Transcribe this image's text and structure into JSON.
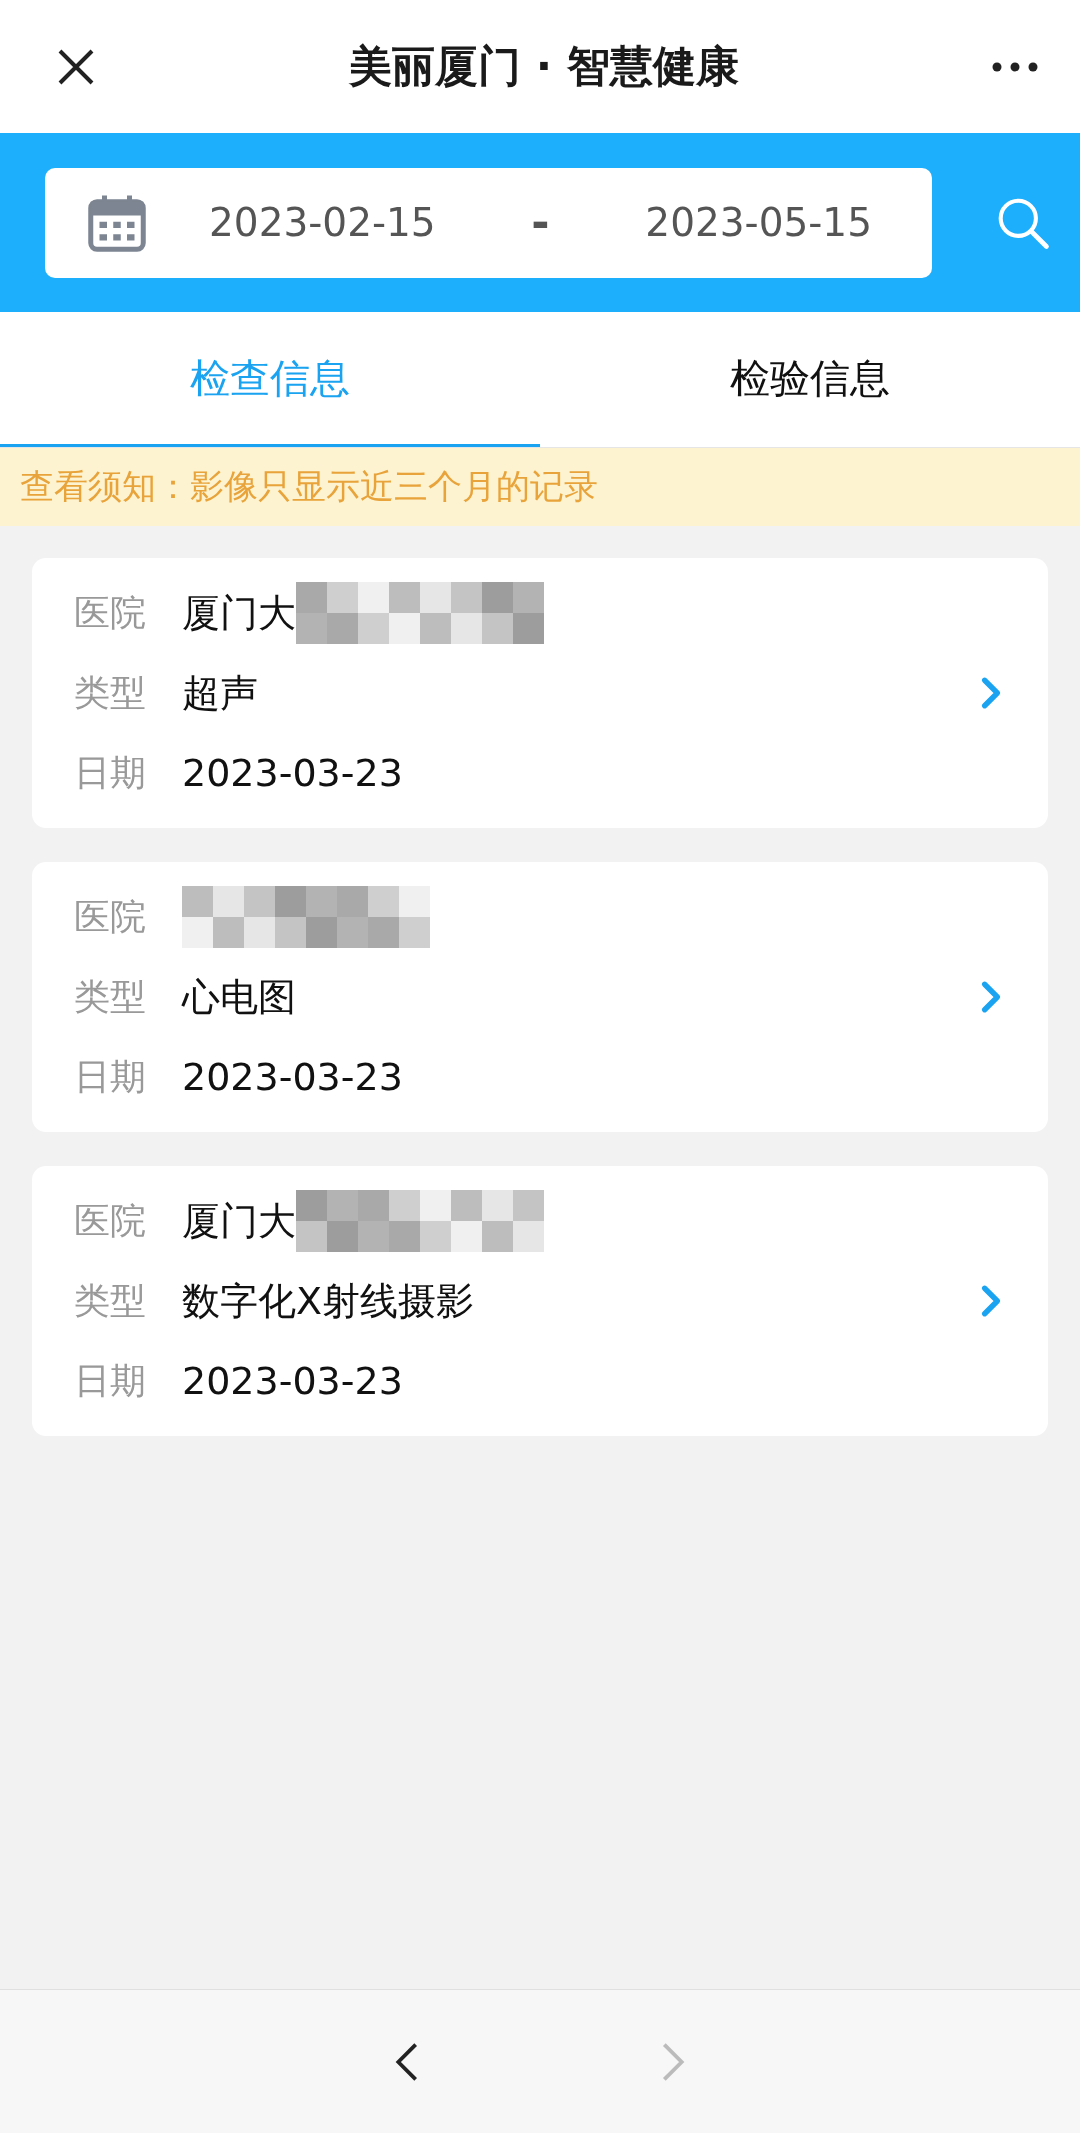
{
  "nav": {
    "title": "美丽厦门 · 智慧健康"
  },
  "date_range": {
    "start": "2023-02-15",
    "separator": "-",
    "end": "2023-05-15"
  },
  "tabs": [
    {
      "label": "检查信息",
      "selected": true
    },
    {
      "label": "检验信息",
      "selected": false
    }
  ],
  "notice": "查看须知：影像只显示近三个月的记录",
  "records": [
    {
      "fields": [
        {
          "label": "医院",
          "value": "厦门大",
          "redacted": true
        },
        {
          "label": "类型",
          "value": "超声"
        },
        {
          "label": "日期",
          "value": "2023-03-23"
        }
      ]
    },
    {
      "fields": [
        {
          "label": "医院",
          "redacted": true
        },
        {
          "label": "类型",
          "value": "心电图"
        },
        {
          "label": "日期",
          "value": "2023-03-23"
        }
      ]
    },
    {
      "fields": [
        {
          "label": "医院",
          "value": "厦门大",
          "redacted": true
        },
        {
          "label": "类型",
          "value": "数字化X射线摄影"
        },
        {
          "label": "日期",
          "value": "2023-03-23"
        }
      ]
    }
  ],
  "bottom_nav": {
    "back_disabled": false,
    "forward_disabled": true
  }
}
